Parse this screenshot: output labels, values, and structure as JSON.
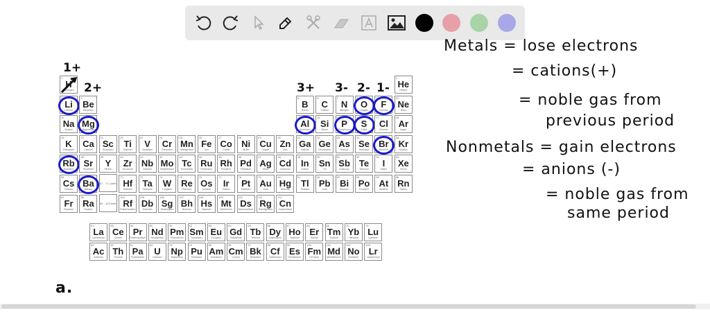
{
  "toolbar": {
    "tools": [
      "undo-icon",
      "redo-icon",
      "select-icon",
      "pen-icon",
      "tools-icon",
      "eraser-icon",
      "text-icon",
      "image-icon"
    ],
    "colors": [
      "#000000",
      "#e8a0a8",
      "#a8d4a8",
      "#a8a8e8"
    ]
  },
  "group_labels": [
    "1+",
    "2+",
    "3+",
    "3-",
    "2-",
    "1-"
  ],
  "notes": [
    "Metals = lose electrons",
    "= cations(+)",
    "= noble gas from",
    "previous period",
    "Nonmetals = gain electrons",
    "= anions (-)",
    "= noble gas from",
    "same period"
  ],
  "bottom_note": "a.",
  "lanthanide_placeholder": "57 - 71 Lanthanides",
  "actinide_placeholder": "89 - 103 Actinides",
  "circled": [
    "Li",
    "Mg",
    "Rb",
    "Ba",
    "Al",
    "P",
    "O",
    "S",
    "F",
    "Br"
  ],
  "crossed": [
    "H"
  ],
  "elements": [
    [
      "H",
      "Hydrogen",
      1,
      1,
      1
    ],
    [
      "He",
      "Helium",
      2,
      1,
      18
    ],
    [
      "Li",
      "Lithium",
      3,
      2,
      1
    ],
    [
      "Be",
      "Beryllium",
      4,
      2,
      2
    ],
    [
      "B",
      "Boron",
      5,
      2,
      13
    ],
    [
      "C",
      "Carbon",
      6,
      2,
      14
    ],
    [
      "N",
      "Nitrogen",
      7,
      2,
      15
    ],
    [
      "O",
      "Oxygen",
      8,
      2,
      16
    ],
    [
      "F",
      "Fluorine",
      9,
      2,
      17
    ],
    [
      "Ne",
      "Neon",
      10,
      2,
      18
    ],
    [
      "Na",
      "Sodium",
      11,
      3,
      1
    ],
    [
      "Mg",
      "Magnesium",
      12,
      3,
      2
    ],
    [
      "Al",
      "Aluminum",
      13,
      3,
      13
    ],
    [
      "Si",
      "Silicon",
      14,
      3,
      14
    ],
    [
      "P",
      "Phosphorus",
      15,
      3,
      15
    ],
    [
      "S",
      "Sulfur",
      16,
      3,
      16
    ],
    [
      "Cl",
      "Chlorine",
      17,
      3,
      17
    ],
    [
      "Ar",
      "Argon",
      18,
      3,
      18
    ],
    [
      "K",
      "Potassium",
      19,
      4,
      1
    ],
    [
      "Ca",
      "Calcium",
      20,
      4,
      2
    ],
    [
      "Sc",
      "Scandium",
      21,
      4,
      3
    ],
    [
      "Ti",
      "Titanium",
      22,
      4,
      4
    ],
    [
      "V",
      "Vanadium",
      23,
      4,
      5
    ],
    [
      "Cr",
      "Chromium",
      24,
      4,
      6
    ],
    [
      "Mn",
      "Manganese",
      25,
      4,
      7
    ],
    [
      "Fe",
      "Iron",
      26,
      4,
      8
    ],
    [
      "Co",
      "Cobalt",
      27,
      4,
      9
    ],
    [
      "Ni",
      "Nickel",
      28,
      4,
      10
    ],
    [
      "Cu",
      "Copper",
      29,
      4,
      11
    ],
    [
      "Zn",
      "Zinc",
      30,
      4,
      12
    ],
    [
      "Ga",
      "Gallium",
      31,
      4,
      13
    ],
    [
      "Ge",
      "Germanium",
      32,
      4,
      14
    ],
    [
      "As",
      "Arsenic",
      33,
      4,
      15
    ],
    [
      "Se",
      "Selenium",
      34,
      4,
      16
    ],
    [
      "Br",
      "Bromine",
      35,
      4,
      17
    ],
    [
      "Kr",
      "Krypton",
      36,
      4,
      18
    ],
    [
      "Rb",
      "Rubidium",
      37,
      5,
      1
    ],
    [
      "Sr",
      "Strontium",
      38,
      5,
      2
    ],
    [
      "Y",
      "Yttrium",
      39,
      5,
      3
    ],
    [
      "Zr",
      "Zirconium",
      40,
      5,
      4
    ],
    [
      "Nb",
      "Niobium",
      41,
      5,
      5
    ],
    [
      "Mo",
      "Molybdenum",
      42,
      5,
      6
    ],
    [
      "Tc",
      "Technetium",
      43,
      5,
      7
    ],
    [
      "Ru",
      "Ruthenium",
      44,
      5,
      8
    ],
    [
      "Rh",
      "Rhodium",
      45,
      5,
      9
    ],
    [
      "Pd",
      "Palladium",
      46,
      5,
      10
    ],
    [
      "Ag",
      "Silver",
      47,
      5,
      11
    ],
    [
      "Cd",
      "Cadmium",
      48,
      5,
      12
    ],
    [
      "In",
      "Indium",
      49,
      5,
      13
    ],
    [
      "Sn",
      "Tin",
      50,
      5,
      14
    ],
    [
      "Sb",
      "Antimony",
      51,
      5,
      15
    ],
    [
      "Te",
      "Tellurium",
      52,
      5,
      16
    ],
    [
      "I",
      "Iodine",
      53,
      5,
      17
    ],
    [
      "Xe",
      "Xenon",
      54,
      5,
      18
    ],
    [
      "Cs",
      "Cesium",
      55,
      6,
      1
    ],
    [
      "Ba",
      "Barium",
      56,
      6,
      2
    ],
    [
      "Hf",
      "Hafnium",
      72,
      6,
      4
    ],
    [
      "Ta",
      "Tantalum",
      73,
      6,
      5
    ],
    [
      "W",
      "Tungsten",
      74,
      6,
      6
    ],
    [
      "Re",
      "Rhenium",
      75,
      6,
      7
    ],
    [
      "Os",
      "Osmium",
      76,
      6,
      8
    ],
    [
      "Ir",
      "Iridium",
      77,
      6,
      9
    ],
    [
      "Pt",
      "Platinum",
      78,
      6,
      10
    ],
    [
      "Au",
      "Gold",
      79,
      6,
      11
    ],
    [
      "Hg",
      "Mercury",
      80,
      6,
      12
    ],
    [
      "Tl",
      "Thallium",
      81,
      6,
      13
    ],
    [
      "Pb",
      "Lead",
      82,
      6,
      14
    ],
    [
      "Bi",
      "Bismuth",
      83,
      6,
      15
    ],
    [
      "Po",
      "Polonium",
      84,
      6,
      16
    ],
    [
      "At",
      "Astatine",
      85,
      6,
      17
    ],
    [
      "Rn",
      "Radon",
      86,
      6,
      18
    ],
    [
      "Fr",
      "Francium",
      87,
      7,
      1
    ],
    [
      "Ra",
      "Radium",
      88,
      7,
      2
    ],
    [
      "Rf",
      "Rutherfordium",
      104,
      7,
      4
    ],
    [
      "Db",
      "Dubnium",
      105,
      7,
      5
    ],
    [
      "Sg",
      "Seaborgium",
      106,
      7,
      6
    ],
    [
      "Bh",
      "Bohrium",
      107,
      7,
      7
    ],
    [
      "Hs",
      "Hassium",
      108,
      7,
      8
    ],
    [
      "Mt",
      "Meitnerium",
      109,
      7,
      9
    ],
    [
      "Ds",
      "Darmstadtium",
      110,
      7,
      10
    ],
    [
      "Rg",
      "Roentgenium",
      111,
      7,
      11
    ],
    [
      "Cn",
      "Copernicium",
      112,
      7,
      12
    ],
    [
      "La",
      "Lanthanum",
      57,
      9,
      1
    ],
    [
      "Ce",
      "Cerium",
      58,
      9,
      2
    ],
    [
      "Pr",
      "Praseodymium",
      59,
      9,
      3
    ],
    [
      "Nd",
      "Neodymium",
      60,
      9,
      4
    ],
    [
      "Pm",
      "Promethium",
      61,
      9,
      5
    ],
    [
      "Sm",
      "Samarium",
      62,
      9,
      6
    ],
    [
      "Eu",
      "Europium",
      63,
      9,
      7
    ],
    [
      "Gd",
      "Gadolinium",
      64,
      9,
      8
    ],
    [
      "Tb",
      "Terbium",
      65,
      9,
      9
    ],
    [
      "Dy",
      "Dysprosium",
      66,
      9,
      10
    ],
    [
      "Ho",
      "Holmium",
      67,
      9,
      11
    ],
    [
      "Er",
      "Erbium",
      68,
      9,
      12
    ],
    [
      "Tm",
      "Thulium",
      69,
      9,
      13
    ],
    [
      "Yb",
      "Ytterbium",
      70,
      9,
      14
    ],
    [
      "Lu",
      "Lutetium",
      71,
      9,
      15
    ],
    [
      "Ac",
      "Actinium",
      89,
      10,
      1
    ],
    [
      "Th",
      "Thorium",
      90,
      10,
      2
    ],
    [
      "Pa",
      "Protactinium",
      91,
      10,
      3
    ],
    [
      "U",
      "Uranium",
      92,
      10,
      4
    ],
    [
      "Np",
      "Neptunium",
      93,
      10,
      5
    ],
    [
      "Pu",
      "Plutonium",
      94,
      10,
      6
    ],
    [
      "Am",
      "Americium",
      95,
      10,
      7
    ],
    [
      "Cm",
      "Curium",
      96,
      10,
      8
    ],
    [
      "Bk",
      "Berkelium",
      97,
      10,
      9
    ],
    [
      "Cf",
      "Californium",
      98,
      10,
      10
    ],
    [
      "Es",
      "Einsteinium",
      99,
      10,
      11
    ],
    [
      "Fm",
      "Fermium",
      100,
      10,
      12
    ],
    [
      "Md",
      "Mendelevium",
      101,
      10,
      13
    ],
    [
      "No",
      "Nobelium",
      102,
      10,
      14
    ],
    [
      "Lr",
      "Lawrencium",
      103,
      10,
      15
    ]
  ]
}
